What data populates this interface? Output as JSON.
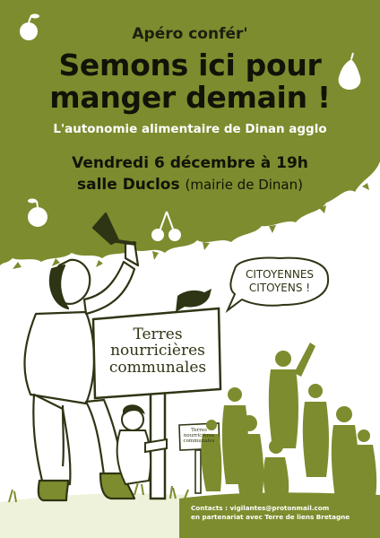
{
  "poster": {
    "kicker": "Apéro confér'",
    "title_line1": "Semons ici pour",
    "title_line2": "manger demain !",
    "subtitle": "L'autonomie alimentaire de Dinan agglo",
    "date": "Vendredi 6 décembre à 19h",
    "venue": "salle Duclos",
    "venue_detail": "(mairie de Dinan)"
  },
  "speech_bubble": {
    "line1": "CITOYENNES",
    "line2": "CITOYENS !"
  },
  "signs": {
    "big_line1": "Terres",
    "big_line2": "nourricières",
    "big_line3": "communales",
    "small_line1": "Terres",
    "small_line2": "nourricières",
    "small_line3": "communales"
  },
  "footer": {
    "contact": "Contacts : vigilantes@protonmail.com",
    "partner": "en partenariat avec Terre de liens Bretagne"
  },
  "colors": {
    "olive": "#7d8c2e",
    "dark": "#121208",
    "white": "#ffffff"
  }
}
